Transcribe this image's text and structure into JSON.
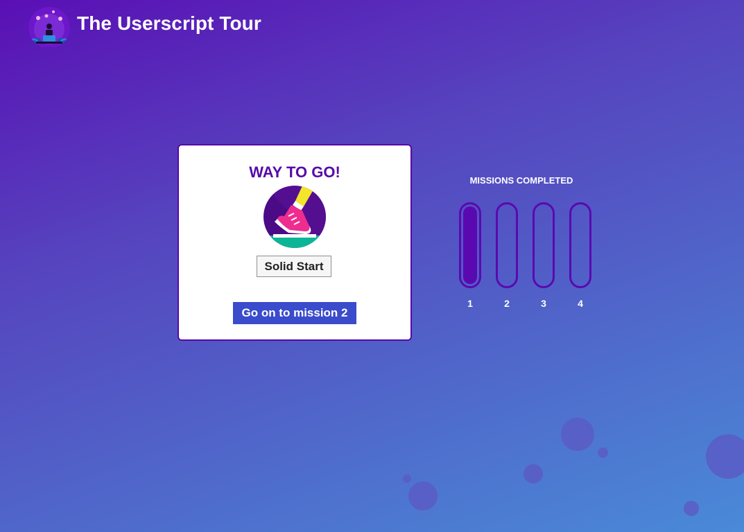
{
  "header": {
    "title": "The Userscript Tour",
    "logo_icon": "userscript-tour-logo"
  },
  "card": {
    "heading": "WAY TO GO!",
    "badge_icon": "running-shoe-icon",
    "badge_label": "Solid Start",
    "next_button": "Go on to mission 2"
  },
  "missions": {
    "heading": "MISSIONS COMPLETED",
    "items": [
      {
        "number": "1",
        "completed": true
      },
      {
        "number": "2",
        "completed": false
      },
      {
        "number": "3",
        "completed": false
      },
      {
        "number": "4",
        "completed": false
      }
    ]
  },
  "colors": {
    "accent": "#5509a8",
    "button": "#3a4bcb",
    "background_start": "#5a0fb5",
    "background_end": "#4a8ad8"
  }
}
